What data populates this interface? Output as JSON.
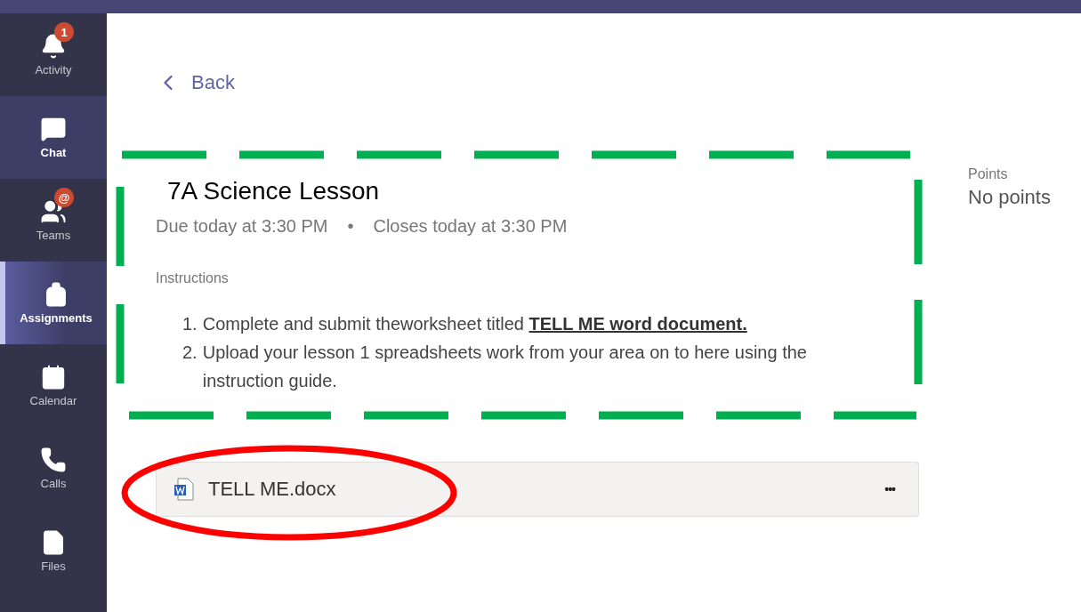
{
  "sidebar": {
    "items": [
      {
        "label": "Activity",
        "selected": false,
        "badge": "1"
      },
      {
        "label": "Chat",
        "selected": false,
        "highlighted": true
      },
      {
        "label": "Teams",
        "selected": false,
        "badge": "@"
      },
      {
        "label": "Assignments",
        "selected": true
      },
      {
        "label": "Calendar",
        "selected": false
      },
      {
        "label": "Calls",
        "selected": false
      },
      {
        "label": "Files",
        "selected": false
      }
    ]
  },
  "back": {
    "label": "Back"
  },
  "assignment": {
    "title": "7A Science Lesson",
    "due": "Due today at 3:30 PM",
    "separator": "•",
    "closes": "Closes today at 3:30 PM",
    "instructions_label": "Instructions",
    "instructions": [
      {
        "number": "1.",
        "text": "Complete and submit theworksheet titled ",
        "link": "TELL ME word document."
      },
      {
        "number": "2.",
        "text": "Upload your lesson 1 spreadsheets work from your area on to here using the instruction guide."
      }
    ]
  },
  "points": {
    "label": "Points",
    "value": "No points"
  },
  "attachment": {
    "name": "TELL ME.docx",
    "more": "•••"
  }
}
